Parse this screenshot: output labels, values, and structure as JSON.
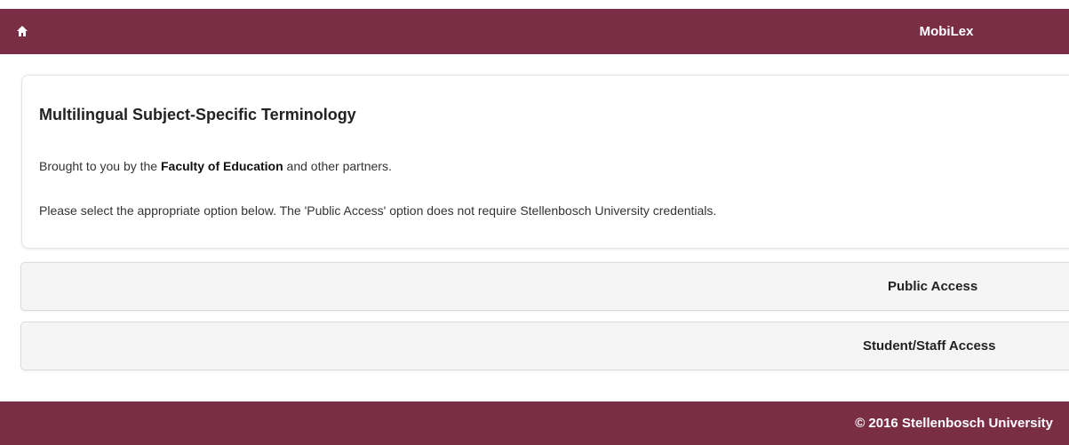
{
  "header": {
    "home_icon": "home-icon",
    "title": "MobiLex"
  },
  "intro": {
    "heading": "Multilingual Subject-Specific Terminology",
    "line1_prefix": "Brought to you by the ",
    "line1_bold": "Faculty of Education",
    "line1_suffix": " and other partners.",
    "line2": "Please select the appropriate option below. The 'Public Access' option does not require Stellenbosch University credentials."
  },
  "options": {
    "public_label": "Public Access",
    "student_label": "Student/Staff Access"
  },
  "footer": {
    "text": "© 2016 Stellenbosch University"
  },
  "colors": {
    "brand": "#7a2e45",
    "button_bg": "#f5f5f5"
  }
}
